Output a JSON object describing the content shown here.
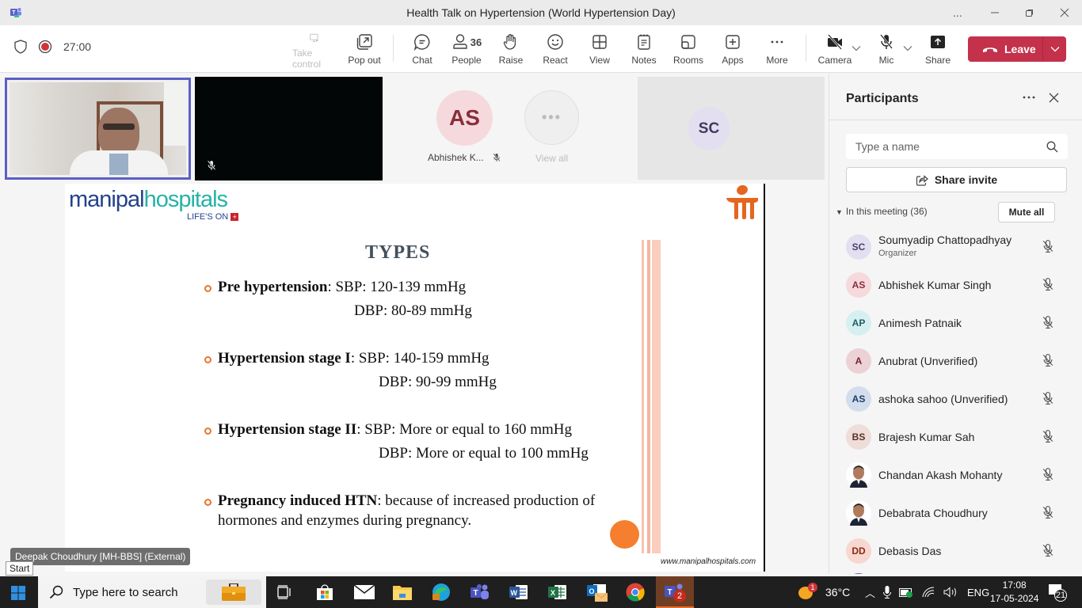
{
  "window": {
    "title": "Health Talk on Hypertension (World Hypertension Day)",
    "more_label": "...",
    "controls": [
      "minimize",
      "restore",
      "close"
    ]
  },
  "toolbar": {
    "timer": "27:00",
    "buttons": [
      {
        "id": "take-control",
        "label": "Take control",
        "icon": "screen-cursor-icon",
        "enabled": false
      },
      {
        "id": "pop-out",
        "label": "Pop out",
        "icon": "pop-out-icon",
        "enabled": true
      },
      {
        "id": "chat",
        "label": "Chat",
        "icon": "chat-bubble-icon",
        "enabled": true
      },
      {
        "id": "people",
        "label": "People",
        "icon": "person-icon",
        "enabled": true,
        "count": "36",
        "active": true
      },
      {
        "id": "raise",
        "label": "Raise",
        "icon": "hand-icon",
        "enabled": true
      },
      {
        "id": "react",
        "label": "React",
        "icon": "smiley-icon",
        "enabled": true
      },
      {
        "id": "view",
        "label": "View",
        "icon": "grid-icon",
        "enabled": true
      },
      {
        "id": "notes",
        "label": "Notes",
        "icon": "notepad-icon",
        "enabled": true
      },
      {
        "id": "rooms",
        "label": "Rooms",
        "icon": "rooms-icon",
        "enabled": true
      },
      {
        "id": "apps",
        "label": "Apps",
        "icon": "plus-box-icon",
        "enabled": true
      },
      {
        "id": "more",
        "label": "More",
        "icon": "ellipsis-icon",
        "enabled": true
      },
      {
        "id": "camera",
        "label": "Camera",
        "icon": "camera-off-icon",
        "enabled": true
      },
      {
        "id": "mic",
        "label": "Mic",
        "icon": "mic-off-icon",
        "enabled": true
      },
      {
        "id": "share",
        "label": "Share",
        "icon": "share-up-icon",
        "enabled": true
      }
    ],
    "leave_label": "Leave",
    "accent": "#5b5fc7",
    "leave_color": "#c4314b"
  },
  "stage": {
    "tiles": [
      {
        "type": "video",
        "name": "Deepak Choudhury [MH-BBS] (External)",
        "pinned": true
      },
      {
        "type": "video-black",
        "muted": true
      },
      {
        "type": "avatar",
        "initials": "AS",
        "name": "Abhishek K...",
        "muted": true
      },
      {
        "type": "view-all",
        "label": "View all"
      },
      {
        "type": "avatar-large",
        "initials": "SC"
      }
    ],
    "speaker_tag": "Deepak Choudhury [MH-BBS] (External)"
  },
  "slide": {
    "logo_main": "manipal",
    "logo_accent": "hospitals",
    "logo_tagline": "LIFE'S ON",
    "title": "TYPES",
    "items": [
      {
        "bold": "Pre hypertension",
        "line1": ": SBP: 120-139 mmHg",
        "line2": "DBP: 80-89 mmHg"
      },
      {
        "bold": "Hypertension stage I",
        "line1": ": SBP: 140-159 mmHg",
        "line2": "DBP: 90-99 mmHg"
      },
      {
        "bold": "Hypertension stage II",
        "line1": ": SBP: More or equal to 160 mmHg",
        "line2": "DBP: More or equal to 100 mmHg"
      },
      {
        "bold": "Pregnancy induced HTN",
        "line1": ": because of increased production of",
        "line2": "hormones and enzymes during pregnancy."
      }
    ],
    "footer": "www.manipalhospitals.com"
  },
  "participants": {
    "title": "Participants",
    "search_placeholder": "Type a name",
    "share_invite": "Share invite",
    "section_label": "In this meeting (36)",
    "mute_all": "Mute all",
    "list": [
      {
        "initials": "SC",
        "name": "Soumyadip Chattopadhyay",
        "role": "Organizer",
        "bg": "#e3dff0",
        "fg": "#4a3f6b"
      },
      {
        "initials": "AS",
        "name": "Abhishek Kumar Singh",
        "role": "",
        "bg": "#f6d9dc",
        "fg": "#8a2d3b"
      },
      {
        "initials": "AP",
        "name": "Animesh Patnaik",
        "role": "",
        "bg": "#d6f0f2",
        "fg": "#1f5e64"
      },
      {
        "initials": "A",
        "name": "Anubrat (Unverified)",
        "role": "",
        "bg": "#ecd1d6",
        "fg": "#7a1f2e"
      },
      {
        "initials": "AS",
        "name": "ashoka sahoo (Unverified)",
        "role": "",
        "bg": "#d2deee",
        "fg": "#1e3d66"
      },
      {
        "initials": "BS",
        "name": "Brajesh Kumar Sah",
        "role": "",
        "bg": "#eeddd9",
        "fg": "#5a2e28"
      },
      {
        "initials": "",
        "name": "Chandan Akash Mohanty",
        "role": "",
        "photo": true,
        "bg": "#ffffff",
        "fg": "#000"
      },
      {
        "initials": "",
        "name": "Debabrata Choudhury",
        "role": "",
        "photo": true,
        "bg": "#ffffff",
        "fg": "#000"
      },
      {
        "initials": "DD",
        "name": "Debasis Das",
        "role": "",
        "bg": "#f7d7cf",
        "fg": "#8a2a12"
      }
    ]
  },
  "taskbar": {
    "start_tooltip": "Start",
    "search_placeholder": "Type here to search",
    "weather": "36°C",
    "weather_badge": "1",
    "language": "ENG",
    "time": "17:08",
    "date": "17-05-2024",
    "notifications": "21",
    "teams_badge": "2",
    "apps": [
      "briefcase-icon",
      "task-view-icon",
      "store-icon",
      "mail-icon",
      "file-explorer-icon",
      "edge-icon",
      "teams-icon",
      "word-icon",
      "excel-icon",
      "outlook-icon",
      "chrome-icon",
      "teams-classic-icon"
    ]
  }
}
